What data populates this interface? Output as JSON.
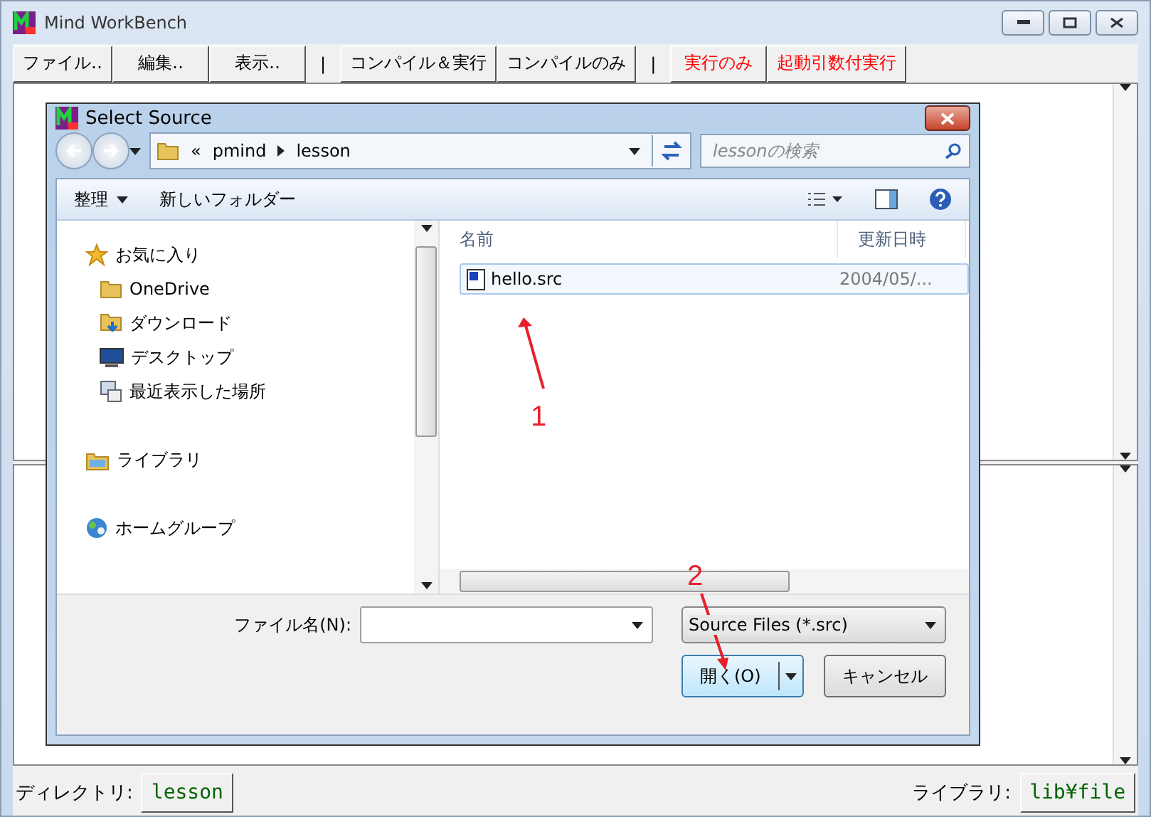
{
  "window": {
    "title": "Mind WorkBench"
  },
  "toolbar": [
    {
      "kind": "button",
      "label": "ファイル‥",
      "color": "#000000"
    },
    {
      "kind": "button",
      "label": "編集‥",
      "color": "#000000"
    },
    {
      "kind": "button",
      "label": "表示‥",
      "color": "#000000"
    },
    {
      "kind": "separator",
      "label": "|"
    },
    {
      "kind": "button",
      "label": "コンパイル＆実行",
      "color": "#000000"
    },
    {
      "kind": "button",
      "label": "コンパイルのみ",
      "color": "#000000"
    },
    {
      "kind": "separator",
      "label": "|"
    },
    {
      "kind": "button",
      "label": "実行のみ",
      "color": "#ff0000"
    },
    {
      "kind": "button",
      "label": "起動引数付実行",
      "color": "#ff0000"
    }
  ],
  "dialog": {
    "title": "Select Source",
    "breadcrumb": [
      "«",
      "pmind",
      "lesson"
    ],
    "search": {
      "placeholder": "lessonの検索"
    },
    "commands": [
      {
        "label": "整理",
        "menu": true
      },
      {
        "label": "新しいフォルダー",
        "menu": false
      }
    ],
    "nav": [
      {
        "kind": "star",
        "label": "お気に入り",
        "children": [
          {
            "kind": "folder",
            "label": "OneDrive"
          },
          {
            "kind": "download",
            "label": "ダウンロード"
          },
          {
            "kind": "desktop",
            "label": "デスクトップ"
          },
          {
            "kind": "recent",
            "label": "最近表示した場所"
          }
        ]
      },
      {
        "kind": "library",
        "label": "ライブラリ"
      },
      {
        "kind": "homegroup",
        "label": "ホームグループ"
      }
    ],
    "columns": [
      "名前",
      "更新日時"
    ],
    "files": [
      {
        "name": "hello.src",
        "modified": "2004/05/...",
        "selected": true
      }
    ],
    "filename_label": "ファイル名(N):",
    "filetype": "Source Files (*.src)",
    "buttons": [
      {
        "kind": "split",
        "label": "開く(O)"
      },
      {
        "kind": "plain",
        "label": "キャンセル"
      }
    ]
  },
  "annotations": [
    {
      "label": "1"
    },
    {
      "label": "2"
    }
  ],
  "status": {
    "directory_label": "ディレクトリ:",
    "directory": "lesson",
    "library_label": "ライブラリ:",
    "library": "lib¥file"
  }
}
